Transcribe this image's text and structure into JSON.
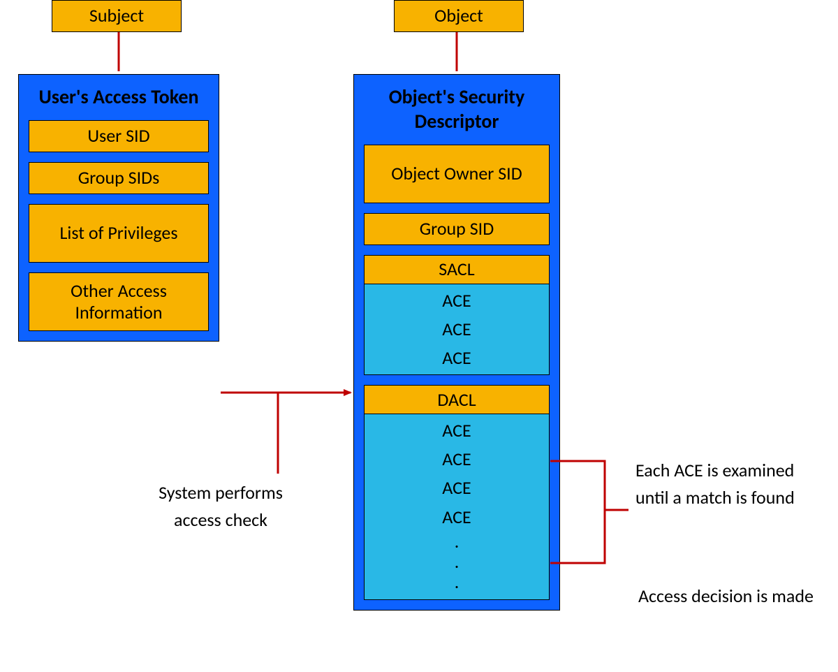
{
  "subject": {
    "label": "Subject"
  },
  "object": {
    "label": "Object"
  },
  "token": {
    "title": "User's Access Token",
    "user_sid": "User SID",
    "group_sids": "Group SIDs",
    "privileges": "List of Privileges",
    "other": "Other Access Information"
  },
  "descriptor": {
    "title": "Object's Security Descriptor",
    "owner_sid": "Object Owner SID",
    "group_sid": "Group SID",
    "sacl": {
      "label": "SACL",
      "aces": [
        "ACE",
        "ACE",
        "ACE"
      ]
    },
    "dacl": {
      "label": "DACL",
      "aces": [
        "ACE",
        "ACE",
        "ACE",
        "ACE",
        ".",
        ".",
        "."
      ]
    }
  },
  "annotations": {
    "access_check": "System performs access check",
    "ace_examined": "Each ACE is examined until a match is found",
    "decision": "Access decision is made"
  },
  "colors": {
    "orange": "#f8b200",
    "blue": "#0d62ff",
    "lightblue": "#29b8e6",
    "red": "#bf0000"
  }
}
